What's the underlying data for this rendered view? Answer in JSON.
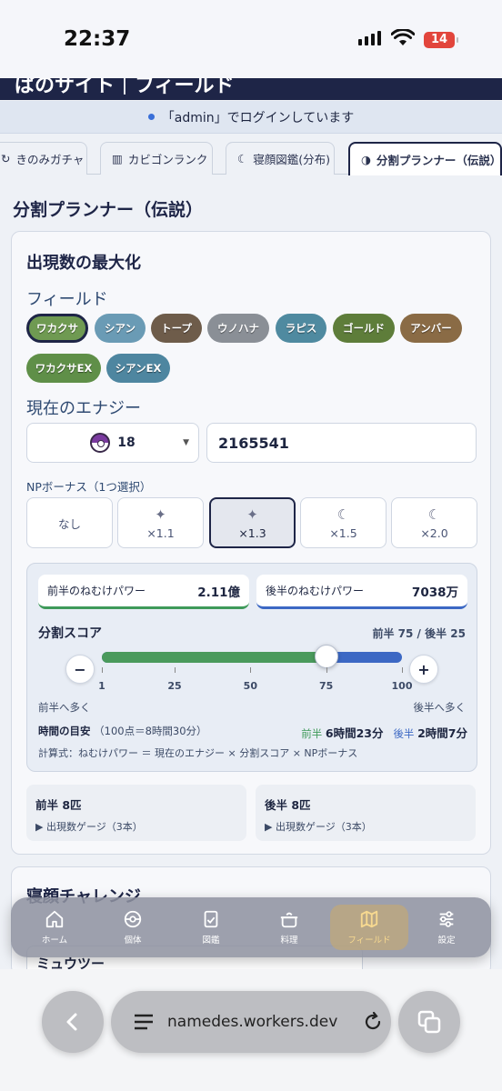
{
  "status": {
    "time": "22:37",
    "battery": "14"
  },
  "header": {
    "title": "ぱのサイト｜フィールド"
  },
  "login": {
    "text": "「admin」でログインしています"
  },
  "tabs": [
    {
      "label": "きのみガチャ"
    },
    {
      "label": "カビゴンランク"
    },
    {
      "label": "寝顔図鑑(分布)"
    },
    {
      "label": "分割プランナー（伝説）"
    }
  ],
  "page": {
    "title": "分割プランナー（伝説）"
  },
  "card": {
    "title": "出現数の最大化",
    "field_label": "フィールド",
    "fields": [
      {
        "label": "ワカクサ",
        "color": "#6f9a52",
        "selected": true
      },
      {
        "label": "シアン",
        "color": "#6a9bb5"
      },
      {
        "label": "トープ",
        "color": "#6e5c4a"
      },
      {
        "label": "ウノハナ",
        "color": "#8a8f96"
      },
      {
        "label": "ラピス",
        "color": "#4f8aa0"
      },
      {
        "label": "ゴールド",
        "color": "#5e7d3a"
      },
      {
        "label": "アンバー",
        "color": "#8a6b45"
      },
      {
        "label": "ワカクサEX",
        "color": "#5f8f48"
      },
      {
        "label": "シアンEX",
        "color": "#4e86a0"
      }
    ],
    "energy_label": "現在のエナジー",
    "level_select": "18",
    "energy_value": "2165541",
    "np_label": "NPボーナス（1つ選択）",
    "np_options": [
      {
        "label": "なし",
        "icon": ""
      },
      {
        "label": "×1.1",
        "icon": "✦"
      },
      {
        "label": "×1.3",
        "icon": "✦",
        "selected": true
      },
      {
        "label": "×1.5",
        "icon": "☾"
      },
      {
        "label": "×2.0",
        "icon": "☾"
      }
    ],
    "first_power_label": "前半のねむけパワー",
    "first_power_value": "2.11億",
    "second_power_label": "後半のねむけパワー",
    "second_power_value": "7038万",
    "score_title": "分割スコア",
    "score_value": "前半 75 / 後半 25",
    "split_value": 75,
    "slider_min": 1,
    "slider_max": 100,
    "ticks": [
      "1",
      "25",
      "50",
      "75",
      "100"
    ],
    "minus": "−",
    "plus": "+",
    "hint_left": "前半へ多く",
    "hint_right": "後半へ多く",
    "time_title": "時間の目安",
    "time_note": "（100点＝8時間30分）",
    "time_first_label": "前半",
    "time_first": "6時間23分",
    "time_second_label": "後半",
    "time_second": "2時間7分",
    "formula": "計算式：ねむけパワー ＝ 現在のエナジー × 分割スコア × NPボーナス",
    "first_half_title": "前半 8匹",
    "first_half_gauge": "▶ 出現数ゲージ（3本）",
    "second_half_title": "後半 8匹",
    "second_half_gauge": "▶ 出現数ゲージ（3本）"
  },
  "card2": {
    "title": "寝顔チャレンジ",
    "select": "ミュウツー"
  },
  "bottom_nav": [
    {
      "label": "ホーム",
      "icon": "home-icon"
    },
    {
      "label": "個体",
      "icon": "pokeball-icon"
    },
    {
      "label": "図鑑",
      "icon": "book-icon"
    },
    {
      "label": "料理",
      "icon": "pot-icon"
    },
    {
      "label": "フィールド",
      "icon": "map-icon",
      "active": true
    },
    {
      "label": "設定",
      "icon": "sliders-icon"
    }
  ],
  "browser": {
    "url": "namedes.workers.dev"
  }
}
